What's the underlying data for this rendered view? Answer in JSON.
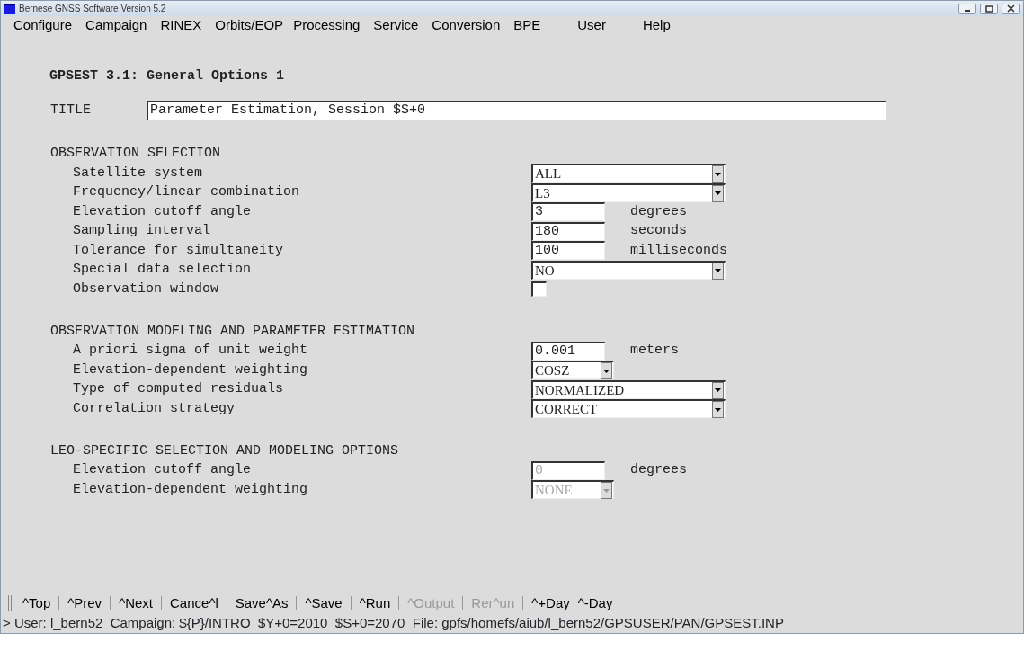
{
  "window": {
    "title": "Bernese GNSS Software Version 5.2"
  },
  "menu": [
    "Configure",
    "Campaign",
    "RINEX",
    "Orbits/EOP",
    "Processing",
    "Service",
    "Conversion",
    "BPE",
    "User",
    "Help"
  ],
  "panel_title": "GPSEST 3.1: General Options 1",
  "title_field": {
    "label": "TITLE",
    "value": "Parameter Estimation, Session $S+0"
  },
  "sections": [
    {
      "heading": "OBSERVATION SELECTION",
      "rows": [
        {
          "label": "Satellite system",
          "kind": "select",
          "value": "ALL",
          "disabled": false
        },
        {
          "label": "Frequency/linear combination",
          "kind": "select",
          "value": "L3",
          "disabled": false
        },
        {
          "label": "Elevation cutoff angle",
          "kind": "input",
          "value": "3",
          "unit": "degrees",
          "disabled": false
        },
        {
          "label": "Sampling interval",
          "kind": "input",
          "value": "180",
          "unit": "seconds",
          "disabled": false
        },
        {
          "label": "Tolerance for simultaneity",
          "kind": "input",
          "value": "100",
          "unit": "milliseconds",
          "disabled": false
        },
        {
          "label": "Special data selection",
          "kind": "select",
          "value": "NO",
          "disabled": false
        },
        {
          "label": "Observation window",
          "kind": "checkbox",
          "checked": false,
          "disabled": false
        }
      ]
    },
    {
      "heading": "OBSERVATION MODELING AND PARAMETER ESTIMATION",
      "rows": [
        {
          "label": "A priori sigma of unit weight",
          "kind": "input",
          "value": "0.001",
          "unit": "meters",
          "disabled": false
        },
        {
          "label": "Elevation-dependent weighting",
          "kind": "short-select",
          "value": "COSZ",
          "disabled": false
        },
        {
          "label": "Type of computed residuals",
          "kind": "select",
          "value": "NORMALIZED",
          "disabled": false
        },
        {
          "label": "Correlation strategy",
          "kind": "select",
          "value": "CORRECT",
          "disabled": false
        }
      ]
    },
    {
      "heading": "LEO-SPECIFIC SELECTION AND MODELING OPTIONS",
      "rows": [
        {
          "label": "Elevation cutoff angle",
          "kind": "input",
          "value": "0",
          "unit": "degrees",
          "disabled": true
        },
        {
          "label": "Elevation-dependent weighting",
          "kind": "short-select",
          "value": "NONE",
          "disabled": true
        }
      ]
    }
  ],
  "toolbar": [
    {
      "label": "^Top",
      "disabled": false
    },
    {
      "label": "^Prev",
      "disabled": false
    },
    {
      "label": "^Next",
      "disabled": false
    },
    {
      "label": "Cance^l",
      "disabled": false
    },
    {
      "label": "Save^As",
      "disabled": false
    },
    {
      "label": "^Save",
      "disabled": false
    },
    {
      "label": "^Run",
      "disabled": false
    },
    {
      "label": "^Output",
      "disabled": true
    },
    {
      "label": "Rer^un",
      "disabled": true
    },
    {
      "label": "^+Day",
      "disabled": false
    },
    {
      "label": "^-Day",
      "disabled": false
    }
  ],
  "status_bar": "> User: l_bern52  Campaign: ${P}/INTRO  $Y+0=2010  $S+0=2070  File: gpfs/homefs/aiub/l_bern52/GPSUSER/PAN/GPSEST.INP"
}
